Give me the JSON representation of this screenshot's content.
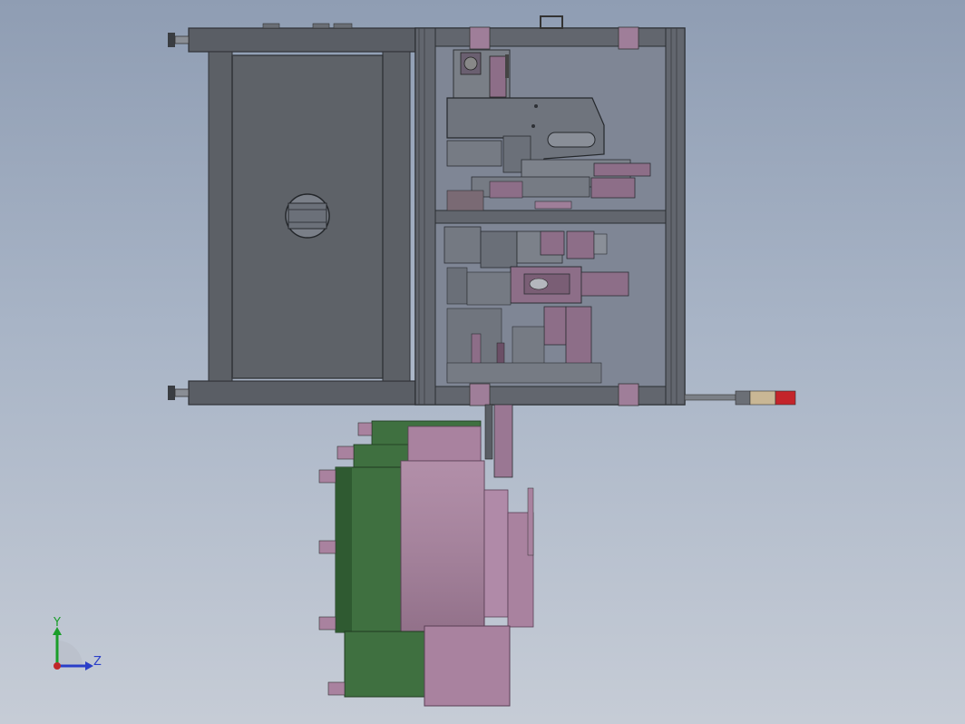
{
  "viewport": {
    "background_top": "#8f9db3",
    "background_bottom": "#c6ccd6"
  },
  "colors": {
    "frame_dark": "#545860",
    "frame_mid": "#6a6f77",
    "panel_gray": "#5e6268",
    "steel": "#7b7f86",
    "part_pink": "#a9829f",
    "part_pink_dark": "#8a6784",
    "part_green": "#3f7040",
    "part_green_dark": "#2f5a31",
    "beacon_red": "#c4242a",
    "beacon_tan": "#c9b795",
    "axis_y": "#1a9e2a",
    "axis_z": "#2a3ec8",
    "axis_origin": "#c0282a"
  },
  "triad": {
    "y_label": "Y",
    "z_label": "Z"
  }
}
